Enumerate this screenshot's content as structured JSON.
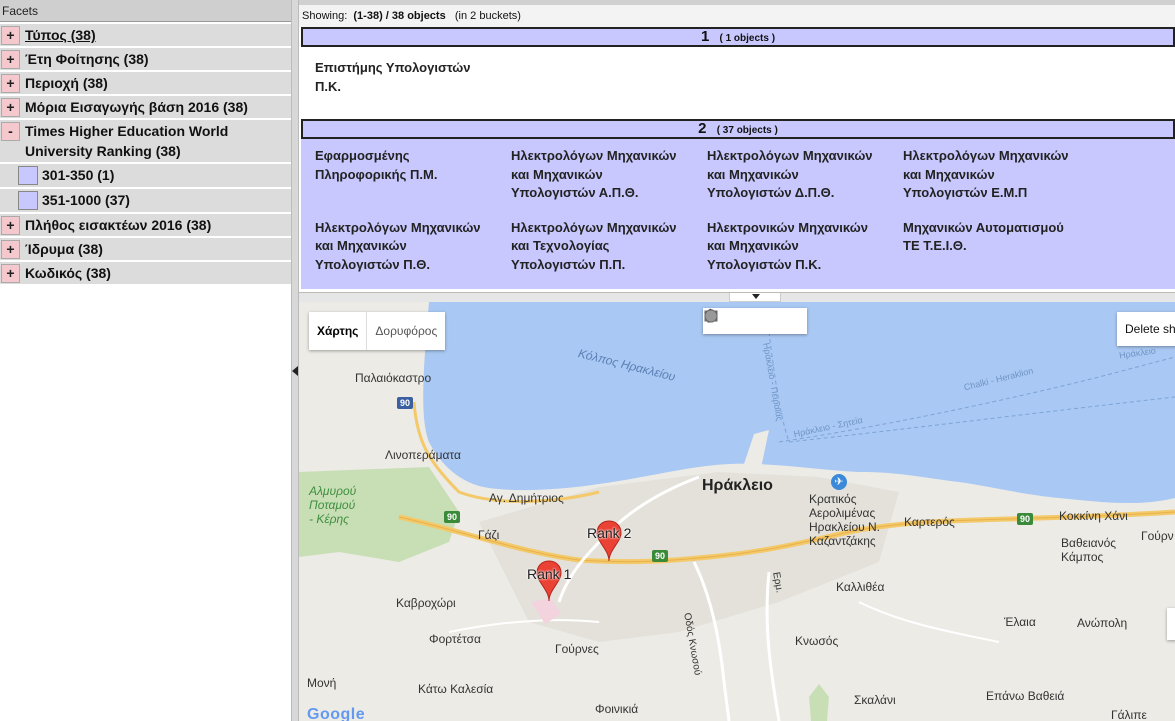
{
  "facets": {
    "header": "Facets",
    "items": [
      {
        "toggle": "+",
        "label": "Τύπος   (38)"
      },
      {
        "toggle": "+",
        "label": "Έτη Φοίτησης   (38)"
      },
      {
        "toggle": "+",
        "label": "Περιοχή   (38)"
      },
      {
        "toggle": "+",
        "label": "Μόρια Εισαγωγής βάση 2016   (38)"
      },
      {
        "toggle": "-",
        "label_line1": "Times Higher Education World",
        "label_line2": "University Ranking   (38)"
      },
      {
        "toggle": "+",
        "label": "Πλήθος εισακτέων 2016   (38)"
      },
      {
        "toggle": "+",
        "label": "Ίδρυμα   (38)"
      },
      {
        "toggle": "+",
        "label": "Κωδικός   (38)"
      }
    ],
    "sub_items": [
      {
        "label": "301-350   (1)"
      },
      {
        "label": "351-1000   (37)"
      }
    ]
  },
  "results": {
    "showing_prefix": "Showing:",
    "range": "(1-38) / 38 objects",
    "buckets_text": "(in 2 buckets)",
    "buckets": [
      {
        "number": "1",
        "count": "( 1 objects )",
        "items": [
          {
            "l1": "Επιστήμης Υπολογιστών",
            "l2": "Π.Κ.",
            "l3": ""
          }
        ]
      },
      {
        "number": "2",
        "count": "( 37 objects )",
        "items": [
          {
            "l1": "Εφαρμοσμένης",
            "l2": "Πληροφορικής Π.Μ.",
            "l3": ""
          },
          {
            "l1": "Ηλεκτρολόγων Μηχανικών",
            "l2": "και Μηχανικών",
            "l3": "Υπολογιστών Α.Π.Θ."
          },
          {
            "l1": "Ηλεκτρολόγων Μηχανικών",
            "l2": "και Μηχανικών",
            "l3": "Υπολογιστών Δ.Π.Θ."
          },
          {
            "l1": "Ηλεκτρολόγων Μηχανικών",
            "l2": "και Μηχανικών",
            "l3": "Υπολογιστών Ε.Μ.Π"
          },
          {
            "l1": "Ηλεκτρολόγων Μηχανικών",
            "l2": "και Μηχανικών",
            "l3": "Υπολογιστών Π.Θ."
          },
          {
            "l1": "Ηλεκτρολόγων Μηχανικών",
            "l2": "και Τεχνολογίας",
            "l3": "Υπολογιστών Π.Π."
          },
          {
            "l1": "Ηλεκτρονικών Μηχανικών",
            "l2": "και Μηχανικών",
            "l3": "Υπολογιστών Π.Κ."
          },
          {
            "l1": "Μηχανικών Αυτοματισμού",
            "l2": "ΤΕ Τ.Ε.Ι.Θ.",
            "l3": ""
          }
        ]
      }
    ]
  },
  "map": {
    "map_type_buttons": [
      "Χάρτης",
      "Δορυφόρος"
    ],
    "delete_button": "Delete sh",
    "tools": [
      "hand-icon",
      "polyline-icon",
      "rectangle-icon",
      "circle-icon"
    ],
    "markers": [
      {
        "label": "Rank 1"
      },
      {
        "label": "Rank 2"
      }
    ],
    "labels": {
      "gulf": "Κόλπος Ηρακλείου",
      "palaiokastro": "Παλαιόκαστρο",
      "linoperamata": "Λινοπεράματα",
      "park": "Αλμυρού\nΠοταμού\n- Κέρης",
      "ag_dimitrios": "Αγ. Δημήτριος",
      "gazi": "Γάζι",
      "irakleio": "Ηράκλειο",
      "airport_l1": "Κρατικός",
      "airport_l2": "Αερολιμένας",
      "airport_l3": "Ηρακλείου Ν.",
      "airport_l4": "Καζαντζάκης",
      "karteros": "Καρτερός",
      "kokkini_xani": "Κοκκίνη Χάνι",
      "vatheianos_kampos_1": "Βαθειανός",
      "vatheianos_kampos_2": "Κάμπος",
      "gouvres_edge": "Γούρν",
      "kavroxori": "Καβροχώρι",
      "kallithea": "Καλλιθέα",
      "elaia": "Έλαια",
      "anopoli": "Ανώπολη",
      "fortetsa": "Φορτέτσα",
      "gournes": "Γούρνες",
      "knosos": "Κνωσός",
      "moni": "Μονή",
      "kato_kalesia": "Κάτω Καλεσία",
      "skalani": "Σκαλάνι",
      "epano_vatheia": "Επάνω Βαθειά",
      "galipe": "Γάλιπε",
      "foinikia": "Φοινικιά",
      "route_irakleio_peiraias": "Ηράκλειο - Πειραιάς",
      "route_irakleio_siteia": "Ηράκλειο - Σητεία",
      "route_chalki_heraklion": "Chalki - Heraklion",
      "route_irakleio_edge": "Ηράκλειο",
      "odos_erm": "Ερμ.",
      "odos_knosou": "Οδός Κνωσού",
      "shield_90": "90",
      "google": "Google"
    }
  }
}
